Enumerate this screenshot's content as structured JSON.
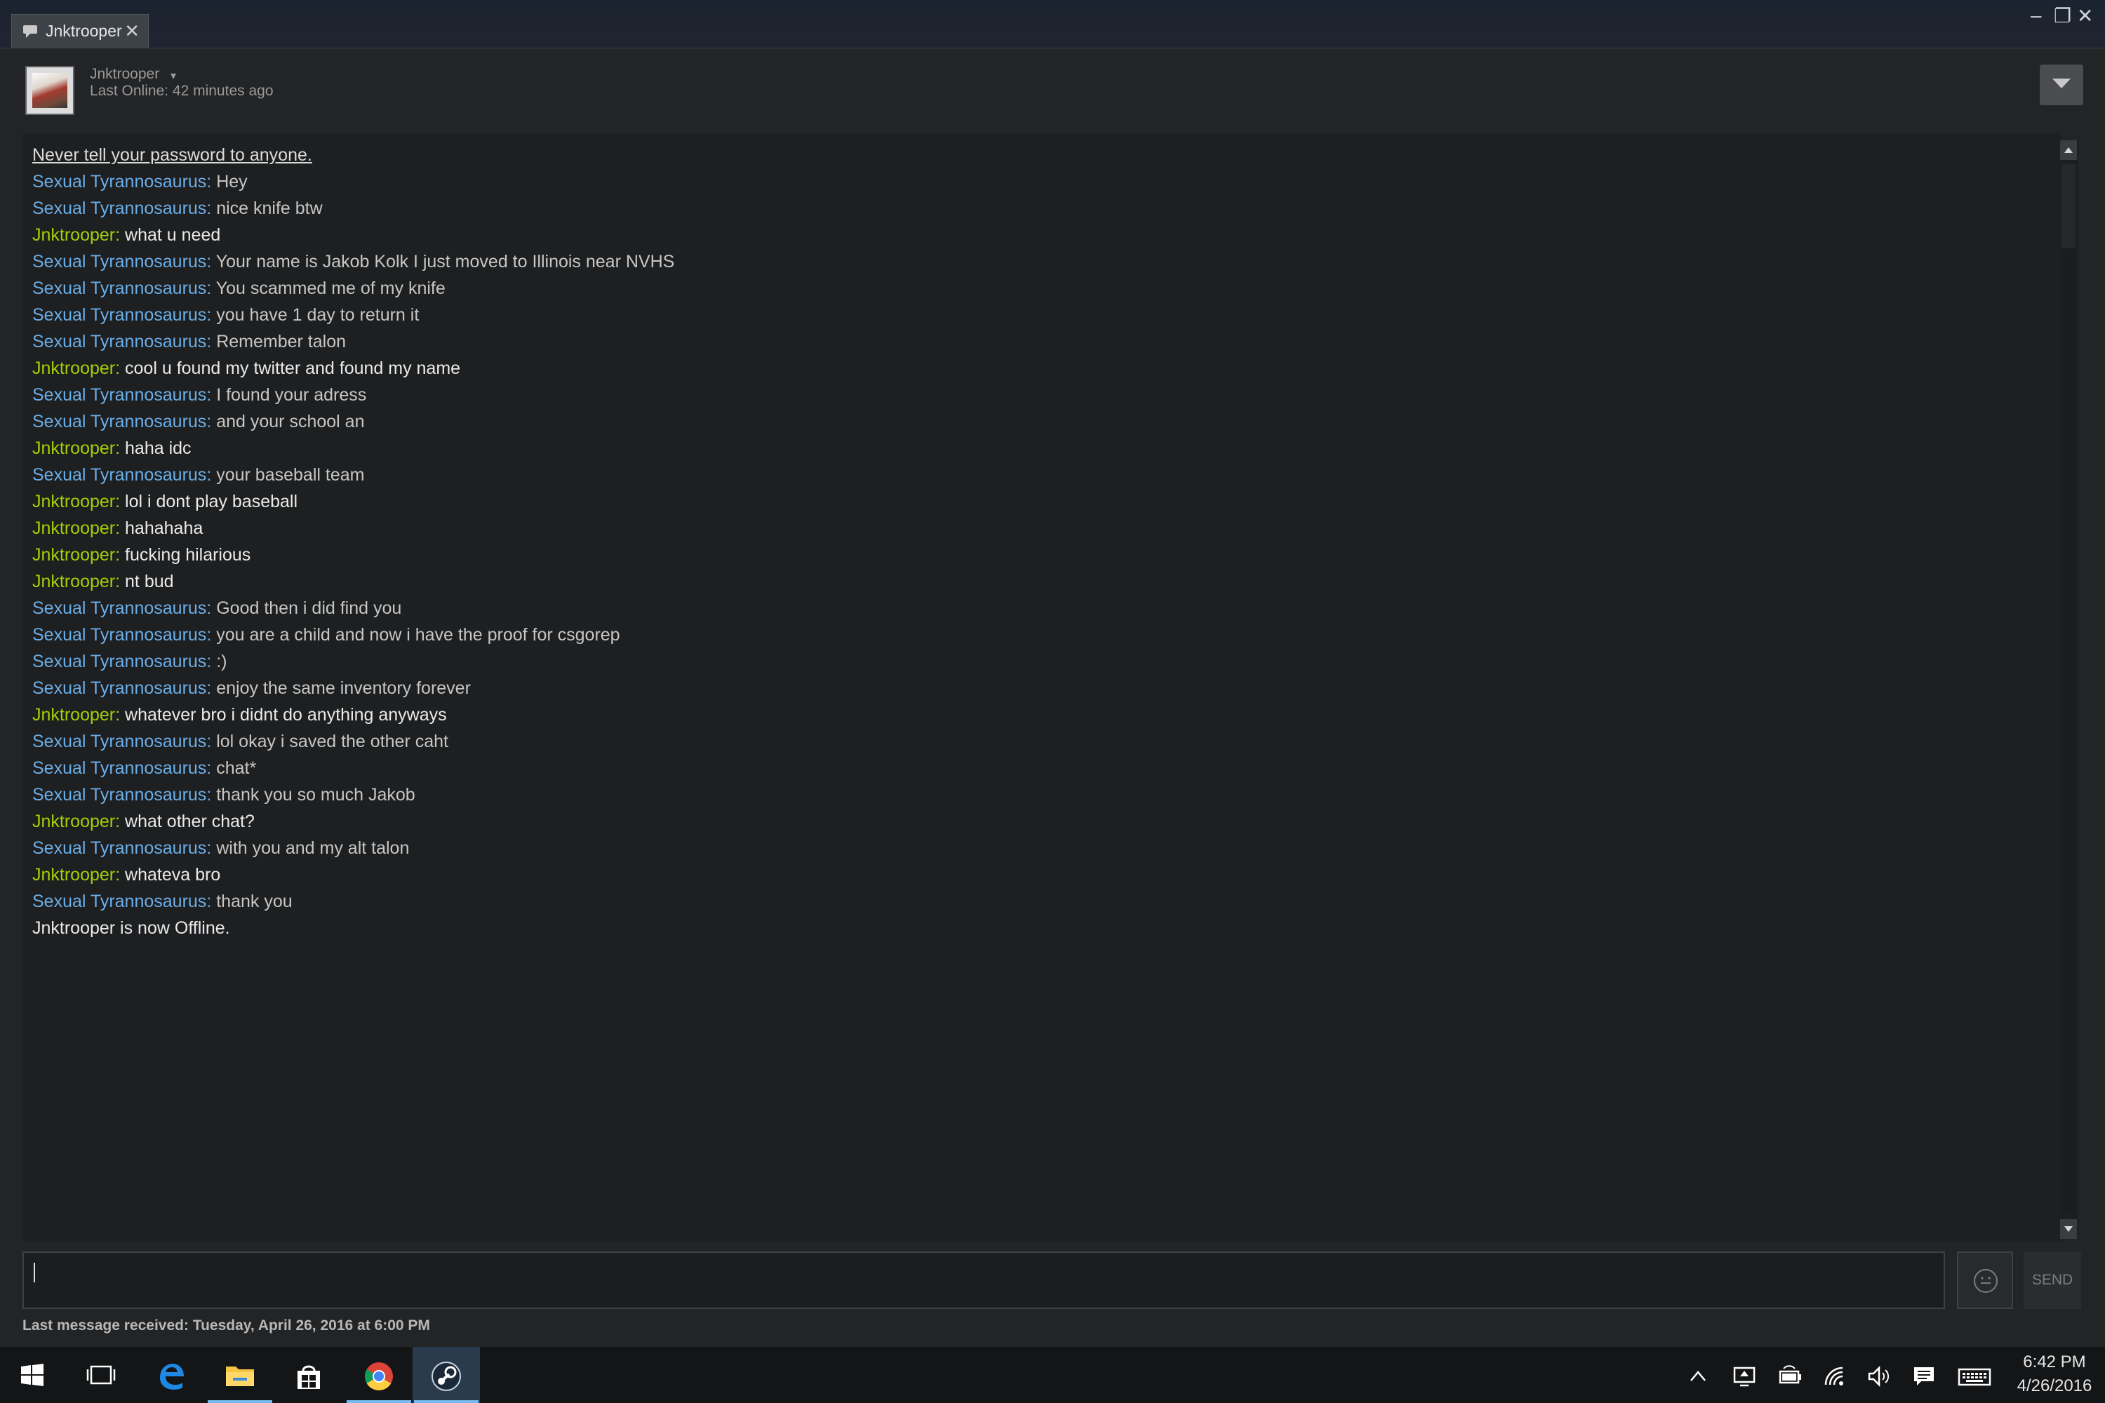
{
  "window": {
    "tab_title": "Jnktrooper",
    "close_glyph": "✕",
    "minimize_glyph": "–",
    "restore_glyph": "❐",
    "window_close_glyph": "✕"
  },
  "friend": {
    "name": "Jnktrooper",
    "status": "Last Online: 42 minutes ago",
    "caret_glyph": "▾"
  },
  "chat": {
    "notice": "Never tell your password to anyone.",
    "messages": [
      {
        "sender": "Sexual Tyrannosaurus",
        "text": "Hey",
        "side": "them"
      },
      {
        "sender": "Sexual Tyrannosaurus",
        "text": "nice knife btw",
        "side": "them"
      },
      {
        "sender": "Jnktrooper",
        "text": "what u need",
        "side": "me"
      },
      {
        "sender": "Sexual Tyrannosaurus",
        "text": "Your name is Jakob Kolk I just moved to Illinois near NVHS",
        "side": "them"
      },
      {
        "sender": "Sexual Tyrannosaurus",
        "text": "You scammed me of my knife",
        "side": "them"
      },
      {
        "sender": "Sexual Tyrannosaurus",
        "text": "you have 1 day to return it",
        "side": "them"
      },
      {
        "sender": "Sexual Tyrannosaurus",
        "text": "Remember talon",
        "side": "them"
      },
      {
        "sender": "Jnktrooper",
        "text": "cool u found my twitter and found my name",
        "side": "me"
      },
      {
        "sender": "Sexual Tyrannosaurus",
        "text": "I found your adress",
        "side": "them"
      },
      {
        "sender": "Sexual Tyrannosaurus",
        "text": "and your school an",
        "side": "them"
      },
      {
        "sender": "Jnktrooper",
        "text": "haha idc",
        "side": "me"
      },
      {
        "sender": "Sexual Tyrannosaurus",
        "text": "your baseball team",
        "side": "them"
      },
      {
        "sender": "Jnktrooper",
        "text": "lol i dont play baseball",
        "side": "me"
      },
      {
        "sender": "Jnktrooper",
        "text": "hahahaha",
        "side": "me"
      },
      {
        "sender": "Jnktrooper",
        "text": "fucking hilarious",
        "side": "me"
      },
      {
        "sender": "Jnktrooper",
        "text": "nt bud",
        "side": "me"
      },
      {
        "sender": "Sexual Tyrannosaurus",
        "text": "Good then i did find you",
        "side": "them"
      },
      {
        "sender": "Sexual Tyrannosaurus",
        "text": "you are a child and now i have the proof for csgorep",
        "side": "them"
      },
      {
        "sender": "Sexual Tyrannosaurus",
        "text": ":)",
        "side": "them"
      },
      {
        "sender": "Sexual Tyrannosaurus",
        "text": "enjoy the same inventory forever",
        "side": "them"
      },
      {
        "sender": "Jnktrooper",
        "text": "whatever bro i didnt do anything anyways",
        "side": "me"
      },
      {
        "sender": "Sexual Tyrannosaurus",
        "text": "lol okay i saved the other caht",
        "side": "them"
      },
      {
        "sender": "Sexual Tyrannosaurus",
        "text": "chat*",
        "side": "them"
      },
      {
        "sender": "Sexual Tyrannosaurus",
        "text": "thank you so much Jakob",
        "side": "them"
      },
      {
        "sender": "Jnktrooper",
        "text": "what other chat?",
        "side": "me"
      },
      {
        "sender": "Sexual Tyrannosaurus",
        "text": "with you and my alt talon",
        "side": "them"
      },
      {
        "sender": "Jnktrooper",
        "text": "whateva bro",
        "side": "me"
      },
      {
        "sender": "Sexual Tyrannosaurus",
        "text": "thank you",
        "side": "them"
      }
    ],
    "status_line": "Jnktrooper is now Offline."
  },
  "composer": {
    "send_label": "SEND",
    "last_message": "Last message received: Tuesday, April 26, 2016 at 6:00 PM"
  },
  "taskbar": {
    "time": "6:42 PM",
    "date": "4/26/2016",
    "apps": [
      "start-icon",
      "task-view-icon",
      "edge-icon",
      "file-explorer-icon",
      "store-icon",
      "chrome-icon",
      "steam-icon"
    ],
    "tray": [
      "chevron-up-icon",
      "display-icon",
      "battery-icon",
      "wifi-icon",
      "volume-icon",
      "action-center-icon",
      "keyboard-icon"
    ]
  },
  "colors": {
    "sender_them": "#6aaee8",
    "sender_me": "#a3cf06",
    "accent": "#76b9ed"
  }
}
